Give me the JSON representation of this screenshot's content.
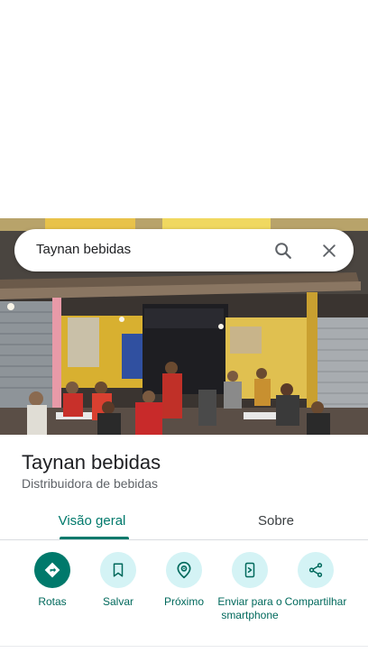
{
  "search": {
    "query": "Taynan bebidas"
  },
  "place": {
    "name": "Taynan bebidas",
    "category": "Distribuidora de bebidas"
  },
  "tabs": [
    {
      "label": "Visão geral",
      "active": true
    },
    {
      "label": "Sobre",
      "active": false
    }
  ],
  "actions": [
    {
      "label": "Rotas",
      "icon": "directions-icon"
    },
    {
      "label": "Salvar",
      "icon": "bookmark-icon"
    },
    {
      "label": "Próximo",
      "icon": "nearby-icon"
    },
    {
      "label": "Enviar para o smartphone",
      "icon": "send-to-phone-icon"
    },
    {
      "label": "Compartilhar",
      "icon": "share-icon"
    }
  ],
  "colors": {
    "accent": "#00796b",
    "action_bg": "#d4f3f5",
    "text_primary": "#202124",
    "text_secondary": "#5f6368"
  }
}
